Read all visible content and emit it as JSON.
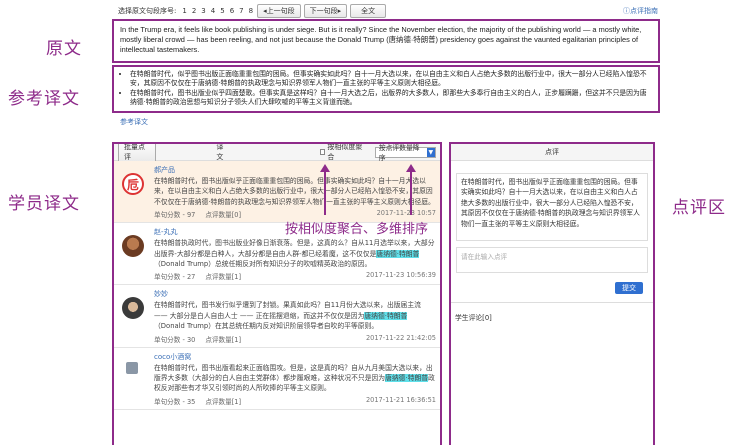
{
  "side_labels": {
    "original": "原文",
    "reference": "参考译文",
    "student": "学员译文",
    "review": "点评区"
  },
  "topbar": {
    "select_label": "选择原文句段序号:",
    "numbers": [
      "1",
      "2",
      "3",
      "4",
      "5",
      "6",
      "7",
      "8"
    ],
    "prev_button": "◂上一句段",
    "next_button": "下一句段▸",
    "full_button": "全文",
    "guide_link": "ⓘ点评指南"
  },
  "original_text": "In the Trump era, it feels like book publishing is under siege. But is it really? Since the November election, the majority of the publishing world — a mostly white, mostly liberal crowd — has been reeling, and not just because the Donald Trump (唐纳德·特朗普) presidency goes against the vaunted egalitarian principles of intellectual tastemakers.",
  "reference": {
    "items": [
      "在特朗普时代，似乎图书出版正面临重重包围的困局。但事实确实如此吗？自十一月大选以来，在以自由主义和白人占绝大多数的出版行业中，很大一部分人已经陷入惶恐不安，其原因不仅仅在于唐纳德·特朗普的执政理念与知识界领军人物们一直主张的平等主义原则大相径庭。",
      "在特朗普时代，图书出版业似乎四面楚歌。但事实真是这样吗？自十一月大选之后，出版界的大多数人，即那些大多奉行自由主义的白人，正步履蹒跚，但这并不只是因为唐纳德·特朗普的政治思想与知识分子领头人们大肆吹嘘的平等主义背道而驰。"
    ],
    "link": "参考译文"
  },
  "left_panel": {
    "batch_button": "批量点评",
    "title": "译文",
    "aggregate_label": "按相似度聚合",
    "sort_label": "按点评数量降序",
    "annotation": "按相似度聚合、多维排序",
    "entries": [
      {
        "user": "郝产品",
        "text_before": "在特朗普时代，图书出版似乎正面临重重包围的困局。但事实确实如此吗？自十一月大选以来，在以自由主义和白人占绝大多数的出版行业中，很大一部分人已经陷入惶恐不安，其原因不仅仅在于唐纳德·特朗普的执政理念与知识界领军人物们一直主张的平等主义原则大相径庭。",
        "highlight": "",
        "text_after": "",
        "sentence_score": "单句分数 - 97",
        "comment_count": "点评数量[0]",
        "date": "2017-11-23 10:57"
      },
      {
        "user": "赵-丸丸",
        "text_before": "在特朗普执政时代，图书出版业好像日渐衰落。但是，这真的么？自从11月选举以来，大部分出版界-大部分都是白种人，大部分都是自由人群-都已经着魔，这不仅仅是",
        "highlight": "唐纳德·特朗普",
        "text_after": "（Donald Trump）总统任期反对所有知识分子的吹嘘精英政治的原因。",
        "sentence_score": "单句分数 - 27",
        "comment_count": "点评数量[1]",
        "date": "2017-11-23 10:56:39"
      },
      {
        "user": "妙妙",
        "text_before": "在特朗普时代，图书发行似乎遭到了封锁。果真如此吗？自11月份大选以来，出版届主流 —— 大部分是白人自由人士 —— 正在摇摆退缩，而这并不仅仅是因为",
        "highlight": "唐纳德·特朗普",
        "text_after": "（Donald Trump）在其总统任期内反对知识阶层领导者自吹的平等原则。",
        "sentence_score": "单句分数 - 30",
        "comment_count": "点评数量[1]",
        "date": "2017-11-22 21:42:05"
      },
      {
        "user": "coco小酒窝",
        "text_before": "在特朗普时代，图书出版看起来正面临围攻。但是，这是真的吗？自从九月美国大选以来，出版界大多数（大部分的白人自由主党群体）都步履艰难，这种状况不只是因为",
        "highlight": "唐纳德·特朗普",
        "text_after": "政权反对那些有才华又引领时尚的人所吹捧的平等主义原则。",
        "sentence_score": "单句分数 - 35",
        "comment_count": "点评数量[1]",
        "date": "2017-11-21 16:36:51"
      }
    ]
  },
  "right_panel": {
    "title": "点评",
    "quote": "在特朗普时代，图书出版似乎正面临重重包围的困局。但事实确实如此吗？自十一月大选以来，在以自由主义和白人占绝大多数的出版行业中，很大一部分人已经陷入惶恐不安，其原因不仅仅在于唐纳德·特朗普的执政理念与知识界领军人物们一直主张的平等主义原则大相径庭。",
    "input_placeholder": "请在此输入点评",
    "submit_button": "提交",
    "student_comments": "学生评论[0]"
  },
  "colors": {
    "annotation": "#8e2b8a",
    "link": "#3b6fb6",
    "primary": "#2f6fd0",
    "highlight": "#5fe0ea",
    "active_row": "#fdf1e4"
  }
}
